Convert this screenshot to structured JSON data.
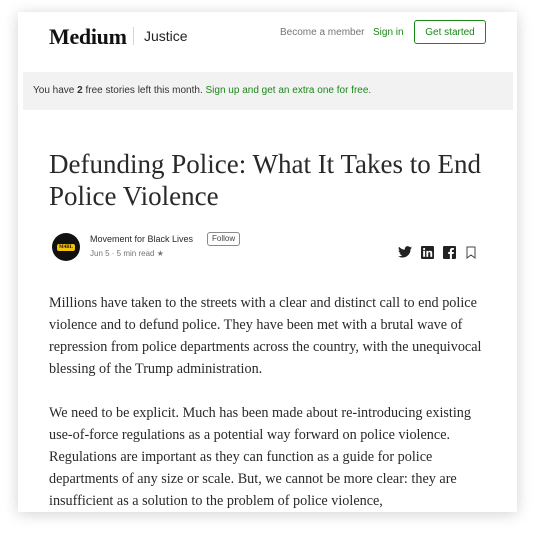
{
  "header": {
    "logo": "Medium",
    "publication": "Justice",
    "become_member": "Become a member",
    "sign_in": "Sign in",
    "get_started": "Get started"
  },
  "banner": {
    "prefix": "You have ",
    "count": "2",
    "middle": " free stories left this month. ",
    "link": "Sign up and get an extra one for free."
  },
  "article": {
    "title": "Defunding Police: What It Takes to End Police Violence",
    "author": "Movement for Black Lives",
    "follow_label": "Follow",
    "meta": "Jun 5 · 5 min read ★",
    "paragraphs": [
      "Millions have taken to the streets with a clear and distinct call to end police violence and to defund police. They have been met with a brutal wave of repression from police departments across the country, with the unequivocal blessing of the Trump administration.",
      "We need to be explicit. Much has been made about re-introducing existing use-of-force regulations as a potential way forward on police violence. Regulations are important as they can function as a guide for police departments of any size or scale. But, we cannot be more clear: they are insufficient as a solution to the problem of police violence,"
    ]
  },
  "share_icons": [
    "twitter-icon",
    "linkedin-icon",
    "facebook-icon",
    "bookmark-icon"
  ],
  "colors": {
    "accent": "#1a8917",
    "banner_bg": "#f2f2f2",
    "text": "#292929"
  }
}
